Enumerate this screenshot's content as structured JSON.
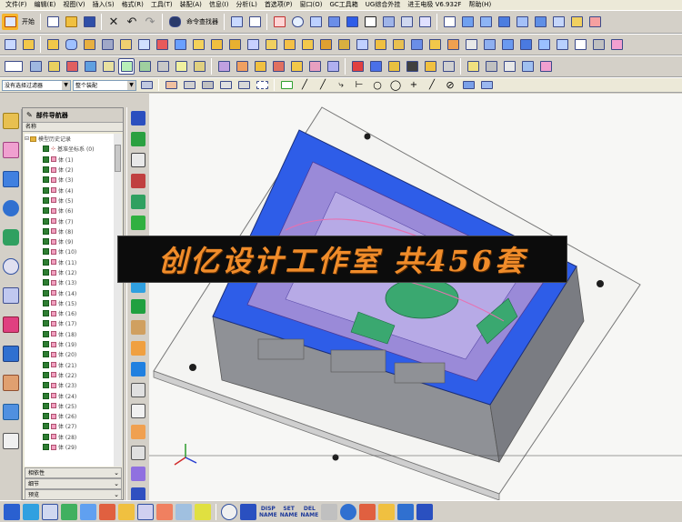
{
  "menubar": {
    "items": [
      "文件(F)",
      "编辑(E)",
      "视图(V)",
      "插入(S)",
      "格式(R)",
      "工具(T)",
      "装配(A)",
      "信息(I)",
      "分析(L)",
      "首选项(P)",
      "窗口(O)",
      "GC工具箱",
      "UG综合外挂",
      "进王电极 V6.932F",
      "帮助(H)"
    ]
  },
  "toolbar": {
    "start_label": "开始",
    "command_finder_label": "命令查找器"
  },
  "selection_bar": {
    "filter_value": "没有选择过滤器",
    "scope_value": "整个装配"
  },
  "navigator": {
    "title": "部件导航器",
    "column_header": "名称",
    "root": "模型历史记录",
    "datum": "基准坐标系 (0)",
    "bodies": [
      "体 (1)",
      "体 (2)",
      "体 (3)",
      "体 (4)",
      "体 (5)",
      "体 (6)",
      "体 (7)",
      "体 (8)",
      "体 (9)",
      "体 (10)",
      "体 (11)",
      "体 (12)",
      "体 (13)",
      "体 (14)",
      "体 (15)",
      "体 (16)",
      "体 (17)",
      "体 (18)",
      "体 (19)",
      "体 (20)",
      "体 (21)",
      "体 (22)",
      "体 (23)",
      "体 (24)",
      "体 (25)",
      "体 (26)",
      "体 (27)",
      "体 (28)",
      "体 (29)"
    ],
    "sections": [
      "相依性",
      "细节",
      "预览"
    ]
  },
  "banner": {
    "text": "创亿设计工作室 共456套"
  },
  "bottom_toolbar": {
    "disp_name": "DISP\nNAME",
    "set_name": "SET\nNAME",
    "del_name": "DEL\nNAME"
  },
  "colors": {
    "mold_blue": "#2e5de8",
    "cavity_purple": "#9a8ad8",
    "core_green": "#3aa870",
    "plate_gray": "#8f9196",
    "banner_text": "#f08c2a"
  },
  "icons": {
    "left_dock": [
      "part-navigator-icon",
      "assembly-navigator-icon",
      "roles-icon",
      "info-icon",
      "web-browser-icon",
      "history-icon",
      "reuse-library-icon",
      "color-palette-icon",
      "constraint-navigator-icon",
      "system-materials-icon",
      "visualization-icon",
      "shell-icon"
    ]
  }
}
